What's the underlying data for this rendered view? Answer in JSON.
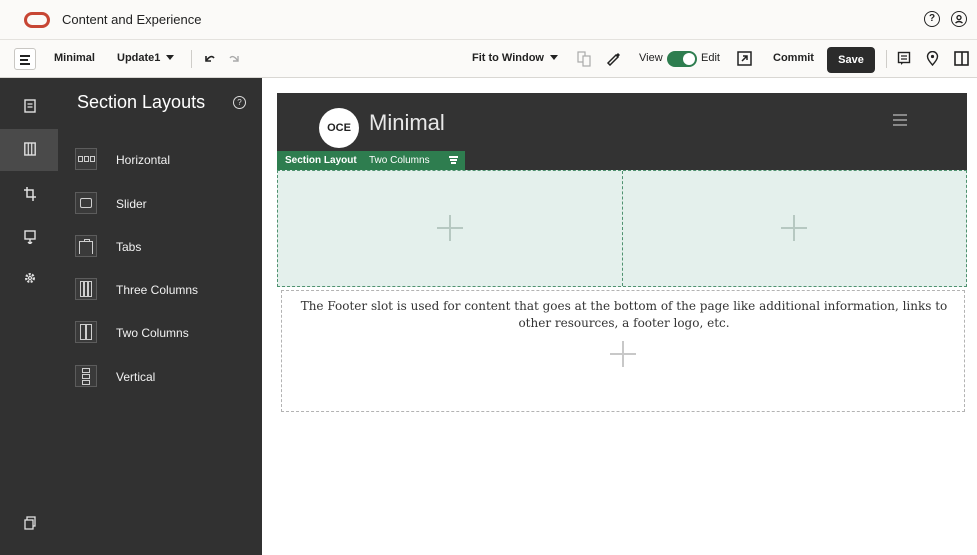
{
  "app": {
    "title": "Content and Experience",
    "brand_color": "#c74634"
  },
  "toolbar": {
    "site_name": "Minimal",
    "update_name": "Update1",
    "fit": "Fit to Window",
    "view_label": "View",
    "edit_label": "Edit",
    "commit_label": "Commit",
    "save_label": "Save",
    "toggle_color": "#2e7d4f"
  },
  "panel": {
    "title": "Section Layouts",
    "help": "?",
    "items": [
      {
        "label": "Horizontal"
      },
      {
        "label": "Slider"
      },
      {
        "label": "Tabs"
      },
      {
        "label": "Three Columns"
      },
      {
        "label": "Two Columns"
      },
      {
        "label": "Vertical"
      }
    ]
  },
  "site": {
    "badge": "OCE",
    "title": "Minimal"
  },
  "section": {
    "tag_label": "Section Layout",
    "tag_value": "Two Columns",
    "color": "#2e7d4f"
  },
  "footer": {
    "text": "The Footer slot is used for content that goes at the bottom of the page like additional information, links to other resources, a footer logo, etc."
  }
}
